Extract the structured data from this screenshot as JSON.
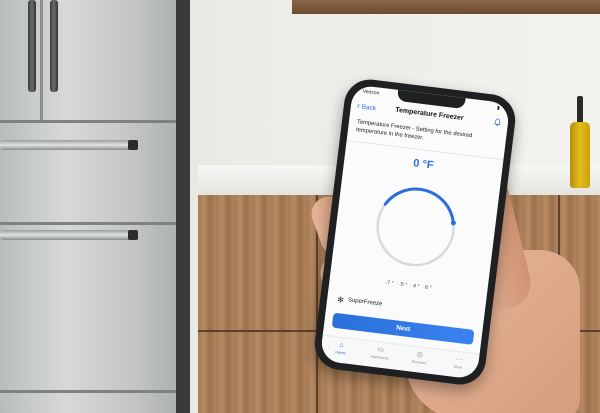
{
  "status_bar": {
    "carrier": "Verizon",
    "battery": "▮"
  },
  "nav": {
    "back_label": "Back",
    "title": "Temperature Freezer",
    "bell_icon": "bell-icon"
  },
  "description": "Temperature Freezer - Setting for the desired temperature in the freezer.",
  "temperature": {
    "value": "0 °F",
    "sub": "· · · · ·"
  },
  "scale_labels": [
    "-7 °",
    "-5 °",
    "4 °",
    "6 °"
  ],
  "superfreeze": {
    "label": "SuperFreeze",
    "icon": "snowflake-icon"
  },
  "next_button": "Next",
  "tabs": [
    {
      "label": "Home",
      "icon": "home-icon",
      "active": true
    },
    {
      "label": "Appliances",
      "icon": "appliances-icon",
      "active": false
    },
    {
      "label": "Discover",
      "icon": "discover-icon",
      "active": false
    },
    {
      "label": "More",
      "icon": "more-icon",
      "active": false
    }
  ],
  "colors": {
    "accent": "#2a6fdb",
    "dial_track": "#d6d9dd"
  },
  "dial_level": 0.38
}
